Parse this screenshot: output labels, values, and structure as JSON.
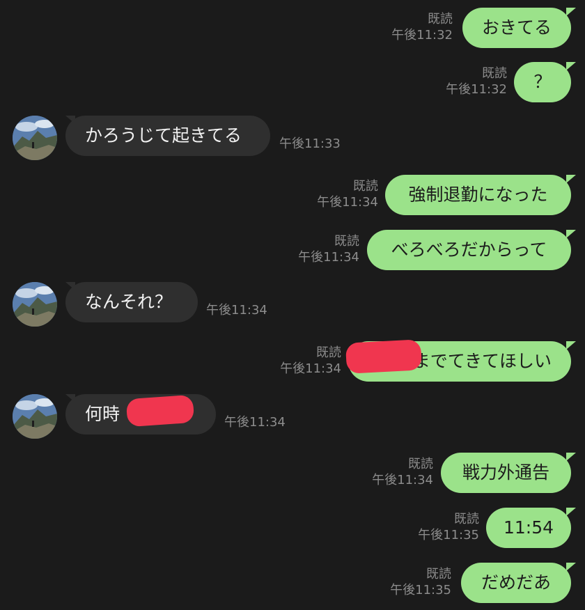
{
  "colors": {
    "background": "#1b1b1b",
    "my_bubble": "#9be28a",
    "their_bubble": "#2f2f2f",
    "meta_text": "#8c8c8c",
    "redaction": "#f0364f"
  },
  "messages": [
    {
      "sender": "me",
      "text": "おきてる",
      "read": "既読",
      "time": "午後11:32"
    },
    {
      "sender": "me",
      "text": "？",
      "read": "既読",
      "time": "午後11:32"
    },
    {
      "sender": "them",
      "text": "かろうじて起きてる",
      "time": "午後11:33",
      "avatar_icon": "profile-photo-mountain"
    },
    {
      "sender": "me",
      "text": "強制退勤になった",
      "read": "既読",
      "time": "午後11:34"
    },
    {
      "sender": "me",
      "text": "べろべろだからって",
      "read": "既読",
      "time": "午後11:34"
    },
    {
      "sender": "them",
      "text": "なんそれ？",
      "time": "午後11:34",
      "avatar_icon": "profile-photo-mountain"
    },
    {
      "sender": "me",
      "text": "までてきてほしい",
      "read": "既読",
      "time": "午後11:34",
      "redacted": true
    },
    {
      "sender": "them",
      "text": "何時",
      "time": "午後11:34",
      "avatar_icon": "profile-photo-mountain",
      "redacted": true
    },
    {
      "sender": "me",
      "text": "戦力外通告",
      "read": "既読",
      "time": "午後11:34"
    },
    {
      "sender": "me",
      "text": "11:54",
      "read": "既読",
      "time": "午後11:35"
    },
    {
      "sender": "me",
      "text": "だめだあ",
      "read": "既読",
      "time": "午後11:35"
    }
  ]
}
